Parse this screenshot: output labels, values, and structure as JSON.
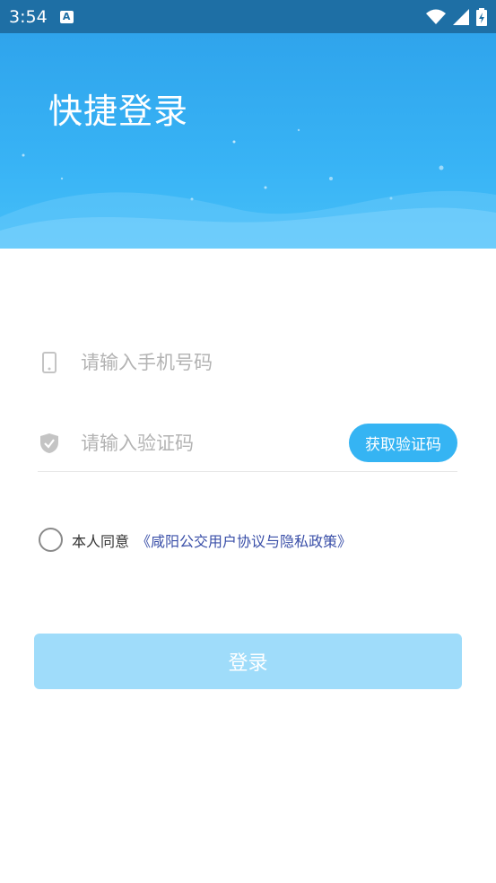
{
  "status_bar": {
    "time": "3:54",
    "notification_icon_letter": "A"
  },
  "header": {
    "title": "快捷登录"
  },
  "phone_field": {
    "placeholder": "请输入手机号码",
    "value": ""
  },
  "code_field": {
    "placeholder": "请输入验证码",
    "value": ""
  },
  "get_code_button": {
    "label": "获取验证码"
  },
  "agreement": {
    "prefix": "本人同意",
    "link": "《咸阳公交用户协议与隐私政策》"
  },
  "login_button": {
    "label": "登录"
  },
  "colors": {
    "header": "#38b3f5",
    "accent": "#35b4f3",
    "link": "#3a4fa8",
    "login_disabled": "#9fdcfa"
  }
}
